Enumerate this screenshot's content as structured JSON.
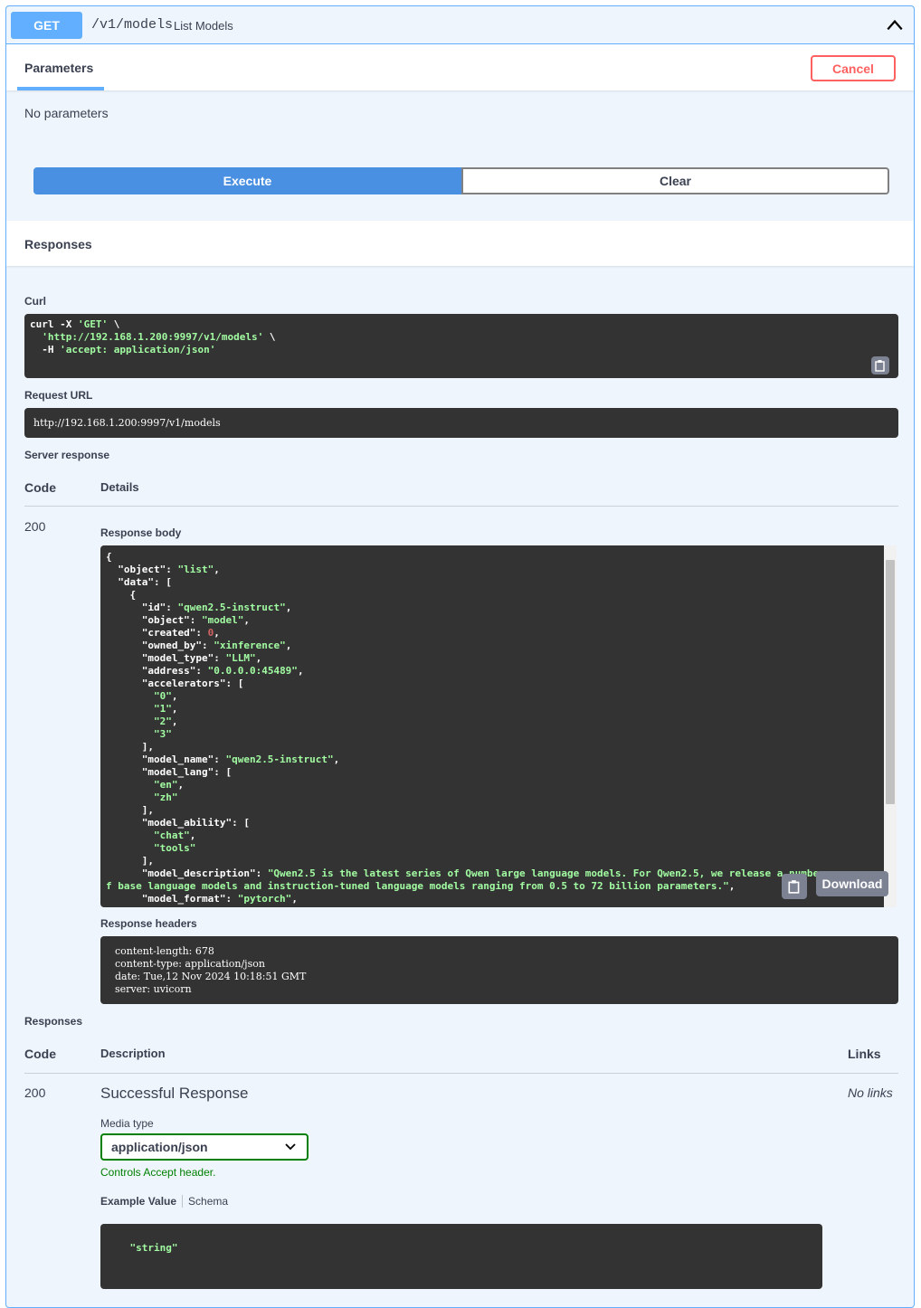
{
  "endpoint": {
    "method": "GET",
    "path": "/v1/models",
    "summary": "List Models"
  },
  "parameters": {
    "tab_label": "Parameters",
    "cancel_label": "Cancel",
    "empty_text": "No parameters",
    "execute_label": "Execute",
    "clear_label": "Clear"
  },
  "responses_section": {
    "title": "Responses",
    "curl_label": "Curl",
    "curl_lines": [
      [
        "curl -X ",
        "'GET'",
        " \\"
      ],
      [
        "  ",
        "'http://192.168.1.200:9997/v1/models'",
        " \\"
      ],
      [
        "  -H ",
        "'accept: application/json'",
        ""
      ]
    ],
    "request_url_label": "Request URL",
    "request_url": "http://192.168.1.200:9997/v1/models",
    "server_response_label": "Server response",
    "code_header": "Code",
    "details_header": "Details",
    "status_code": "200",
    "response_body_label": "Response body",
    "download_label": "Download",
    "response_headers_label": "Response headers",
    "response_headers": [
      "content-length: 678",
      "content-type: application/json",
      "date: Tue,12 Nov 2024 10:18:51 GMT",
      "server: uvicorn"
    ]
  },
  "response_body_lines": [
    [
      [
        "p",
        "{"
      ]
    ],
    [
      [
        "p",
        "  \"object\": "
      ],
      [
        "s",
        "\"list\""
      ],
      [
        "p",
        ","
      ]
    ],
    [
      [
        "p",
        "  \"data\": ["
      ]
    ],
    [
      [
        "p",
        "    {"
      ]
    ],
    [
      [
        "p",
        "      \"id\": "
      ],
      [
        "s",
        "\"qwen2.5-instruct\""
      ],
      [
        "p",
        ","
      ]
    ],
    [
      [
        "p",
        "      \"object\": "
      ],
      [
        "s",
        "\"model\""
      ],
      [
        "p",
        ","
      ]
    ],
    [
      [
        "p",
        "      \"created\": "
      ],
      [
        "n",
        "0"
      ],
      [
        "p",
        ","
      ]
    ],
    [
      [
        "p",
        "      \"owned_by\": "
      ],
      [
        "s",
        "\"xinference\""
      ],
      [
        "p",
        ","
      ]
    ],
    [
      [
        "p",
        "      \"model_type\": "
      ],
      [
        "s",
        "\"LLM\""
      ],
      [
        "p",
        ","
      ]
    ],
    [
      [
        "p",
        "      \"address\": "
      ],
      [
        "s",
        "\"0.0.0.0:45489\""
      ],
      [
        "p",
        ","
      ]
    ],
    [
      [
        "p",
        "      \"accelerators\": ["
      ]
    ],
    [
      [
        "p",
        "        "
      ],
      [
        "s",
        "\"0\""
      ],
      [
        "p",
        ","
      ]
    ],
    [
      [
        "p",
        "        "
      ],
      [
        "s",
        "\"1\""
      ],
      [
        "p",
        ","
      ]
    ],
    [
      [
        "p",
        "        "
      ],
      [
        "s",
        "\"2\""
      ],
      [
        "p",
        ","
      ]
    ],
    [
      [
        "p",
        "        "
      ],
      [
        "s",
        "\"3\""
      ]
    ],
    [
      [
        "p",
        "      ],"
      ]
    ],
    [
      [
        "p",
        "      \"model_name\": "
      ],
      [
        "s",
        "\"qwen2.5-instruct\""
      ],
      [
        "p",
        ","
      ]
    ],
    [
      [
        "p",
        "      \"model_lang\": ["
      ]
    ],
    [
      [
        "p",
        "        "
      ],
      [
        "s",
        "\"en\""
      ],
      [
        "p",
        ","
      ]
    ],
    [
      [
        "p",
        "        "
      ],
      [
        "s",
        "\"zh\""
      ]
    ],
    [
      [
        "p",
        "      ],"
      ]
    ],
    [
      [
        "p",
        "      \"model_ability\": ["
      ]
    ],
    [
      [
        "p",
        "        "
      ],
      [
        "s",
        "\"chat\""
      ],
      [
        "p",
        ","
      ]
    ],
    [
      [
        "p",
        "        "
      ],
      [
        "s",
        "\"tools\""
      ]
    ],
    [
      [
        "p",
        "      ],"
      ]
    ],
    [
      [
        "p",
        "      \"model_description\": "
      ],
      [
        "s",
        "\"Qwen2.5 is the latest series of Qwen large language models. For Qwen2.5, we release a number o"
      ]
    ],
    [
      [
        "s",
        "f base language models and instruction-tuned language models ranging from 0.5 to 72 billion parameters.\""
      ],
      [
        "p",
        ","
      ]
    ],
    [
      [
        "p",
        "      \"model_format\": "
      ],
      [
        "s",
        "\"pytorch\""
      ],
      [
        "p",
        ","
      ]
    ]
  ],
  "documented_responses": {
    "title": "Responses",
    "code_header": "Code",
    "description_header": "Description",
    "links_header": "Links",
    "code": "200",
    "description": "Successful Response",
    "links": "No links",
    "media_type_label": "Media type",
    "media_type_value": "application/json",
    "accept_note": "Controls Accept header.",
    "example_tab": "Example Value",
    "schema_tab": "Schema",
    "example_value": "\"string\""
  },
  "colors": {
    "get_accent": "#61affe",
    "execute": "#4990e2",
    "cancel": "#ff6060",
    "code_bg": "#333333",
    "string_green": "#a2fca2",
    "number_red": "#d36363",
    "accept_green": "#008000"
  },
  "icons": [
    "chevron-up-icon",
    "copy-icon",
    "chevron-down-icon"
  ]
}
